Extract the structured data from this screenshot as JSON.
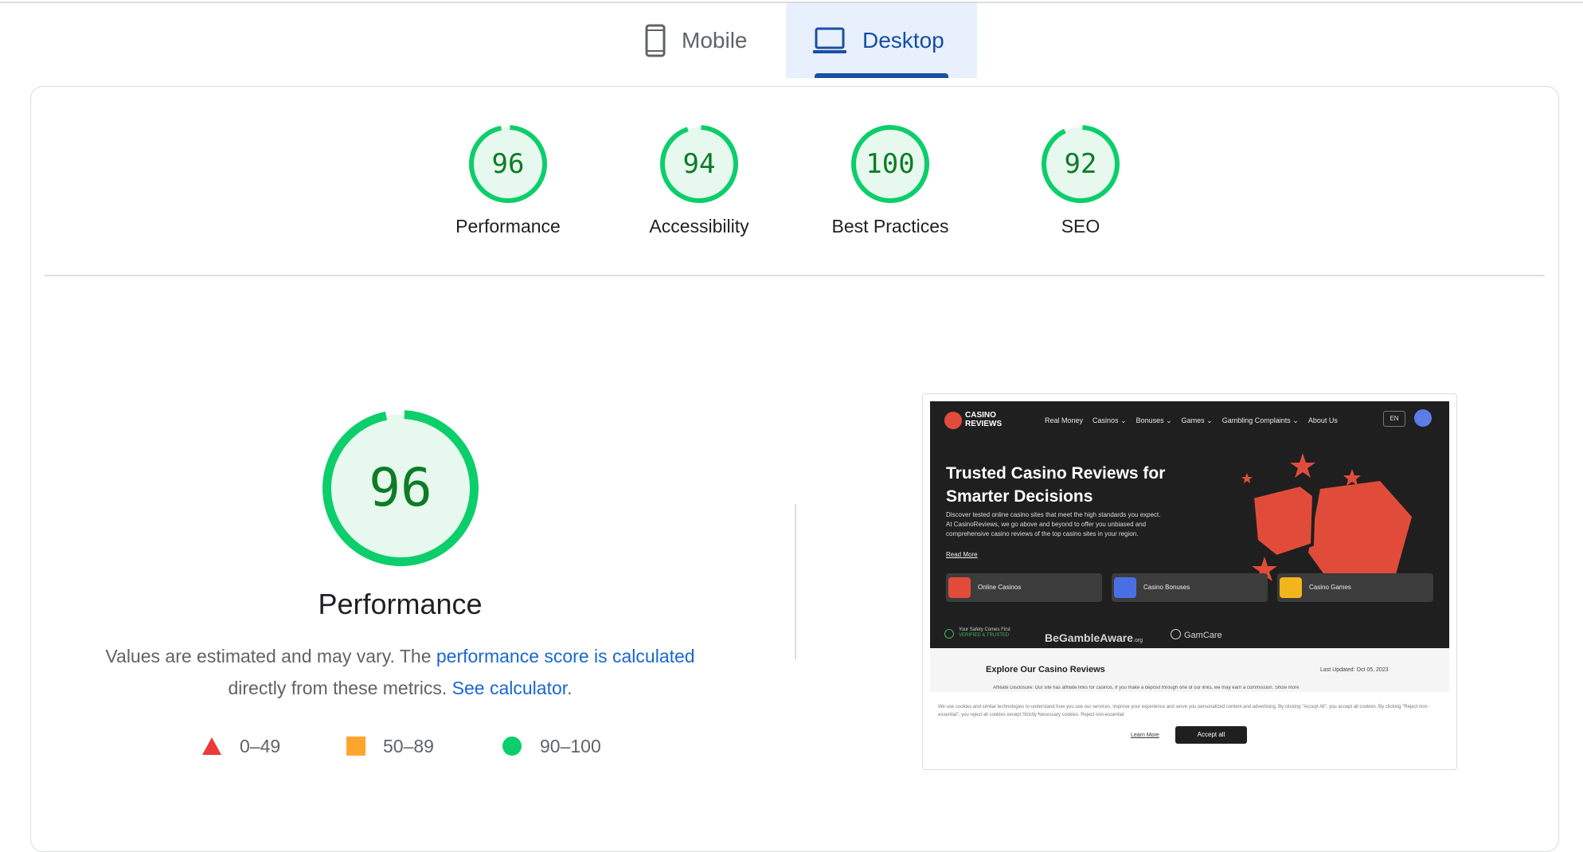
{
  "tabs": [
    {
      "label": "Mobile",
      "icon": "phone-icon",
      "selected": false
    },
    {
      "label": "Desktop",
      "icon": "laptop-icon",
      "selected": true
    }
  ],
  "gauges": [
    {
      "score": 96,
      "label": "Performance"
    },
    {
      "score": 94,
      "label": "Accessibility"
    },
    {
      "score": 100,
      "label": "Best Practices"
    },
    {
      "score": 92,
      "label": "SEO"
    }
  ],
  "performance": {
    "score": 96,
    "title": "Performance",
    "desc_part1": "Values are estimated and may vary. The ",
    "desc_link1": "performance score is calculated",
    "desc_part2": " directly from these metrics. ",
    "desc_link2": "See calculator",
    "desc_end": "."
  },
  "legend": [
    {
      "range": "0–49",
      "shape": "triangle",
      "color": "#eb3a3a"
    },
    {
      "range": "50–89",
      "shape": "square",
      "color": "#ffa52e"
    },
    {
      "range": "90–100",
      "shape": "circle",
      "color": "#0cce6b"
    }
  ],
  "colors": {
    "pass": "#0cce6b",
    "pass_text": "#0c7c26",
    "pass_fill": "#e7f8ee",
    "accent": "#1a4fa3",
    "link": "#1967d2"
  },
  "screenshot": {
    "logo_line1": "CASINO",
    "logo_line2": "REVIEWS",
    "nav": [
      "Real Money",
      "Casinos ⌄",
      "Bonuses ⌄",
      "Games ⌄",
      "Gambling Complaints ⌄",
      "About Us"
    ],
    "lang": "EN",
    "hero_title": "Trusted Casino Reviews for Smarter Decisions",
    "hero_text": "Discover tested online casino sites that meet the high standards you expect. At CasinoReviews, we go above and beyond to offer you unbiased and comprehensive casino reviews of the top casino sites in your region.",
    "hero_link": "Read More",
    "categories": [
      "Online Casinos",
      "Casino Bonuses",
      "Casino Games"
    ],
    "trust_line1": "Your Safety Comes First",
    "trust_line2": "VERIFIED & TRUSTED",
    "begambleaware": "BeGambleAware",
    "begambleaware_suffix": ".org",
    "gamcare": "GamCare",
    "explore_title": "Explore Our Casino Reviews",
    "last_updated": "Last Updated: Oct 05, 2023",
    "affiliate": "Affiliate Disclosure: Our site has affiliate links for casinos. If you make a deposit through one of our links, we may earn a commission. Show more",
    "cookie_text": "We use cookies and similar technologies to understand how you use our services, improve your experience and serve you personalized content and advertising. By clicking \"Accept All\", you accept all cookies. By clicking \"Reject non-essential\", you reject all cookies except Strictly Necessary cookies. Reject non-essential",
    "learn_more": "Learn More",
    "accept_all": "Accept all"
  }
}
